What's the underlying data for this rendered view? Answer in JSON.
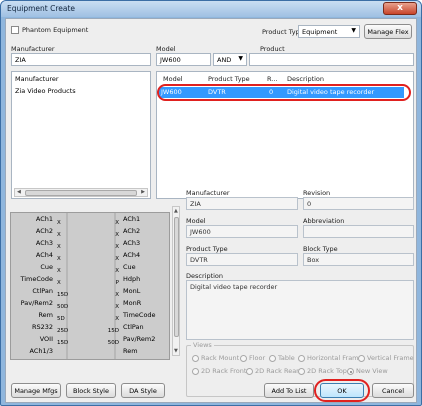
{
  "window": {
    "title": "Equipment Create",
    "close_glyph": "x"
  },
  "phantom": {
    "label": "Phantom Equipment",
    "checked": false
  },
  "product_type": {
    "label": "Product Type",
    "value": "Equipment"
  },
  "manage_flex": "Manage Flex",
  "manufacturer": {
    "label": "Manufacturer",
    "value": "ZIA"
  },
  "model": {
    "label": "Model",
    "value": "JW600"
  },
  "and_op": "AND",
  "product": {
    "label": "Product",
    "value": ""
  },
  "manufacturer_list": {
    "header": "Manufacturer",
    "items": [
      "Zia Video Products"
    ]
  },
  "results": {
    "headers": [
      "Model",
      "Product Type",
      "R...",
      "Description"
    ],
    "rows": [
      {
        "model": "JW600",
        "type": "DVTR",
        "rev": "0",
        "description": "Digital video tape recorder"
      }
    ]
  },
  "scroll_arrows": {
    "left": "◀",
    "right": "▶",
    "up": "▲",
    "down": "▼"
  },
  "block_diagram": {
    "left_pins": [
      "ACh1",
      "ACh2",
      "ACh3",
      "ACh4",
      "Cue",
      "TimeCode",
      "CtlPan",
      "Pav/Rem2",
      "Rem",
      "RS232",
      "VOII",
      "ACh1/3"
    ],
    "left_tags": [
      "X",
      "X",
      "X",
      "X",
      "X",
      "X",
      "15D",
      "50D",
      "5D",
      "25D",
      "15D"
    ],
    "right_pins": [
      "ACh1",
      "ACh2",
      "ACh3",
      "ACh4",
      "Cue",
      "Hdph",
      "MonL",
      "MonR",
      "TimeCode",
      "CtlPan",
      "Pav/Rem2",
      "Rem"
    ],
    "right_tags": [
      "X",
      "X",
      "X",
      "X",
      "X",
      "P",
      "X",
      "X",
      "X",
      "15D",
      "50D"
    ]
  },
  "details": {
    "manufacturer": {
      "label": "Manufacturer",
      "value": "ZIA"
    },
    "revision": {
      "label": "Revision",
      "value": "0"
    },
    "model": {
      "label": "Model",
      "value": "JW600"
    },
    "abbreviation": {
      "label": "Abbreviation",
      "value": ""
    },
    "product_type": {
      "label": "Product Type",
      "value": "DVTR"
    },
    "block_type": {
      "label": "Block Type",
      "value": "Box"
    },
    "description": {
      "label": "Description",
      "value": "Digital video tape recorder"
    }
  },
  "views": {
    "label": "Views",
    "options": [
      "Rack Mount",
      "Floor",
      "Table",
      "Horizontal Frame",
      "Vertical Frame",
      "2D Rack Front",
      "2D Rack Rear",
      "2D Rack Top",
      "New View"
    ],
    "selected": "New View"
  },
  "buttons": {
    "manage_mfgs": "Manage Mfgs",
    "block_style": "Block Style",
    "da_style": "DA Style",
    "add_to_list": "Add To List",
    "ok": "OK",
    "cancel": "Cancel"
  },
  "colors": {
    "selection": "#3399ff",
    "highlight_oval": "#e0211f",
    "title_bar": "#9fc0e3"
  }
}
